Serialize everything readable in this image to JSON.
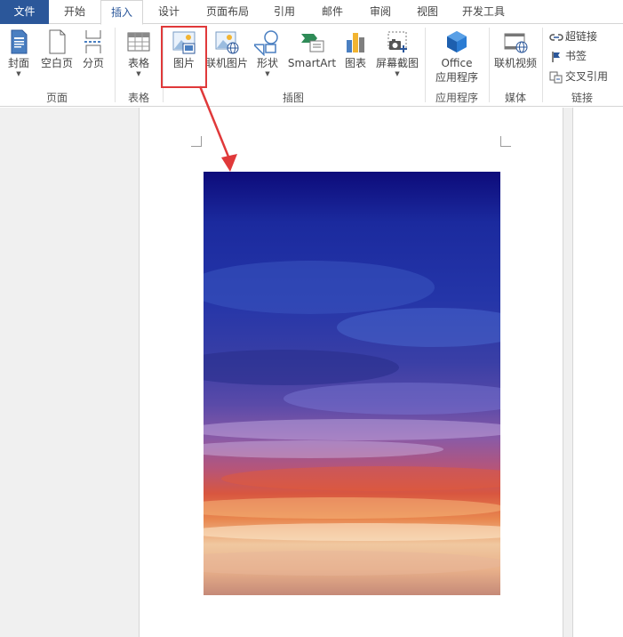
{
  "tabs": {
    "file": "文件",
    "home": "开始",
    "insert": "插入",
    "design": "设计",
    "layout": "页面布局",
    "references": "引用",
    "mailings": "邮件",
    "review": "审阅",
    "view": "视图",
    "developer": "开发工具"
  },
  "ribbon": {
    "pages": {
      "group_label": "页面",
      "cover": "封面",
      "blank": "空白页",
      "break": "分页"
    },
    "tables": {
      "group_label": "表格",
      "table": "表格"
    },
    "illustrations": {
      "group_label": "插图",
      "pictures": "图片",
      "online_pictures": "联机图片",
      "shapes": "形状",
      "smartart": "SmartArt",
      "chart": "图表",
      "screenshot": "屏幕截图"
    },
    "apps": {
      "group_label": "应用程序",
      "office_line1": "Office",
      "office_line2": "应用程序"
    },
    "media": {
      "group_label": "媒体",
      "online_video": "联机视频"
    },
    "links": {
      "group_label": "链接",
      "hyperlink": "超链接",
      "bookmark": "书签",
      "cross_reference": "交叉引用"
    }
  },
  "colors": {
    "file_tab": "#2b579a",
    "accent": "#2b579a",
    "highlight": "#e0393a"
  }
}
